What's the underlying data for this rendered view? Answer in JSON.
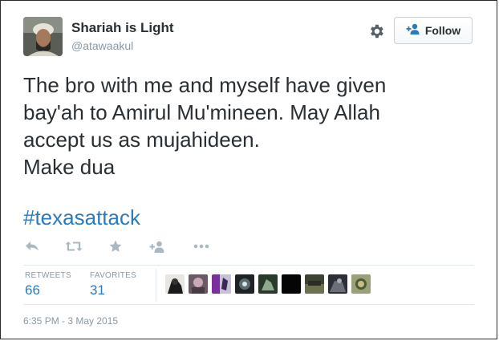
{
  "user": {
    "display_name": "Shariah is Light",
    "handle": "@atawaakul"
  },
  "follow_button": {
    "label": "Follow"
  },
  "tweet": {
    "lines": [
      "The bro with me and myself have given",
      "bay'ah to Amirul Mu'mineen. May Allah",
      "accept us as mujahideen.",
      "Make dua"
    ],
    "hashtag": "#texasattack"
  },
  "actions": {
    "icons": [
      "reply-icon",
      "retweet-icon",
      "favorite-icon",
      "follow-icon",
      "more-icon"
    ]
  },
  "stats": {
    "retweets_label": "RETWEETS",
    "retweets_count": "66",
    "favorites_label": "FAVORITES",
    "favorites_count": "31"
  },
  "favoriter_avatars_count": 9,
  "timestamp": "6:35 PM - 3 May 2015",
  "colors": {
    "link": "#2b7bb9",
    "text": "#292f33",
    "muted": "#8899a6",
    "border": "#e1e8ed"
  }
}
